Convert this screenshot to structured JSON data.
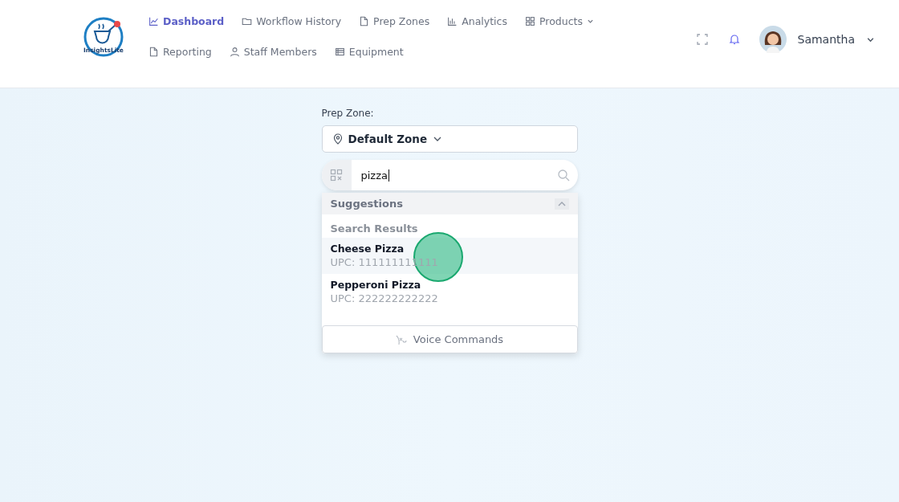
{
  "header": {
    "logo_text": "InsightsLite",
    "nav": [
      {
        "label": "Dashboard",
        "selected": true,
        "caret": false
      },
      {
        "label": "Workflow History",
        "selected": false,
        "caret": false
      },
      {
        "label": "Prep Zones",
        "selected": false,
        "caret": false
      },
      {
        "label": "Analytics",
        "selected": false,
        "caret": false
      },
      {
        "label": "Products",
        "selected": false,
        "caret": true
      },
      {
        "label": "Reporting",
        "selected": false,
        "caret": false
      },
      {
        "label": "Staff Members",
        "selected": false,
        "caret": false
      },
      {
        "label": "Equipment",
        "selected": false,
        "caret": false
      }
    ],
    "user": {
      "name": "Samantha"
    }
  },
  "prep_zone": {
    "label": "Prep Zone:",
    "value": "Default Zone"
  },
  "search": {
    "value": "pizza"
  },
  "suggestions": {
    "title": "Suggestions",
    "expanded": true,
    "section": "Search Results",
    "results": [
      {
        "name": "Cheese Pizza",
        "upc": "UPC: 111111111111",
        "selected": true
      },
      {
        "name": "Pepperoni Pizza",
        "upc": "UPC: 222222222222",
        "selected": false
      }
    ],
    "voice_button": "Voice Commands"
  },
  "click_marker": {
    "kind": "click"
  }
}
